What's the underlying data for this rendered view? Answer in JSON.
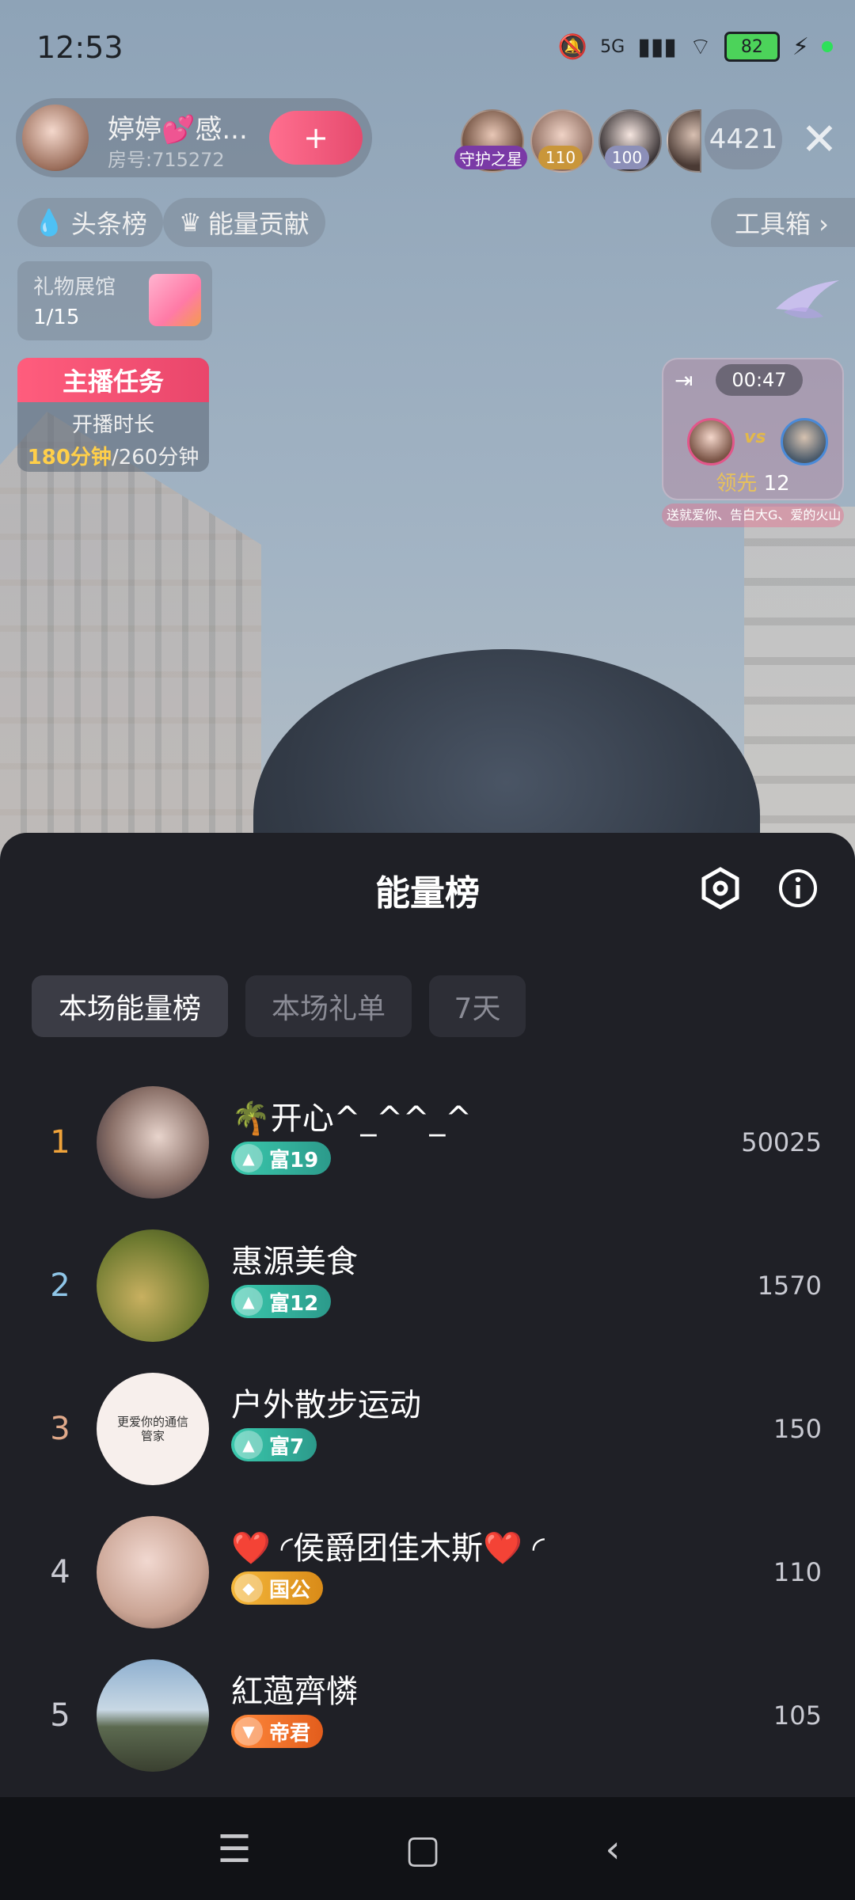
{
  "status_bar": {
    "time": "12:53",
    "network": "5G",
    "battery": "82"
  },
  "host": {
    "name": "婷婷💕感...",
    "room": "房号:715272",
    "follow_icon": "+"
  },
  "viewers": {
    "badges": [
      "守护之星",
      "110",
      "100"
    ],
    "count": "4421"
  },
  "chips": {
    "headline": "头条榜",
    "energy_contrib": "能量贡献",
    "toolbox": "工具箱 ›"
  },
  "gift_hall": {
    "title": "礼物展馆",
    "count": "1/15"
  },
  "host_task": {
    "header": "主播任务",
    "subtitle": "开播时长",
    "progress_done": "180分钟",
    "progress_total": "/260分钟"
  },
  "pk": {
    "timer": "00:47",
    "vs": "vs",
    "lead_label": "领先",
    "lead_value": "12",
    "ticker": "送就爱你、告白大G、爱的火山 送就爱你"
  },
  "sheet": {
    "title": "能量榜",
    "tabs": [
      "本场能量榜",
      "本场礼单",
      "7天"
    ],
    "rows": [
      {
        "rank": "1",
        "name": "🌴开心^_^^_^",
        "level": "富19",
        "level_type": "rich",
        "score": "50025",
        "rank_color": "#f0a33a"
      },
      {
        "rank": "2",
        "name": "惠源美食",
        "level": "富12",
        "level_type": "rich",
        "score": "1570",
        "rank_color": "#8fc6e8"
      },
      {
        "rank": "3",
        "name": "户外散步运动",
        "level": "富7",
        "level_type": "rich",
        "score": "150",
        "rank_color": "#e0a98a"
      },
      {
        "rank": "4",
        "name": "❤️ ◜侯爵团佳木斯❤️ ◜",
        "level": "国公",
        "level_type": "duke",
        "score": "110",
        "rank_color": "#c9cad2"
      },
      {
        "rank": "5",
        "name": "紅薖齊憐",
        "level": "帝君",
        "level_type": "emperor",
        "score": "105",
        "rank_color": "#c9cad2"
      }
    ],
    "avatar3_text": "更爱你的通信管家"
  }
}
